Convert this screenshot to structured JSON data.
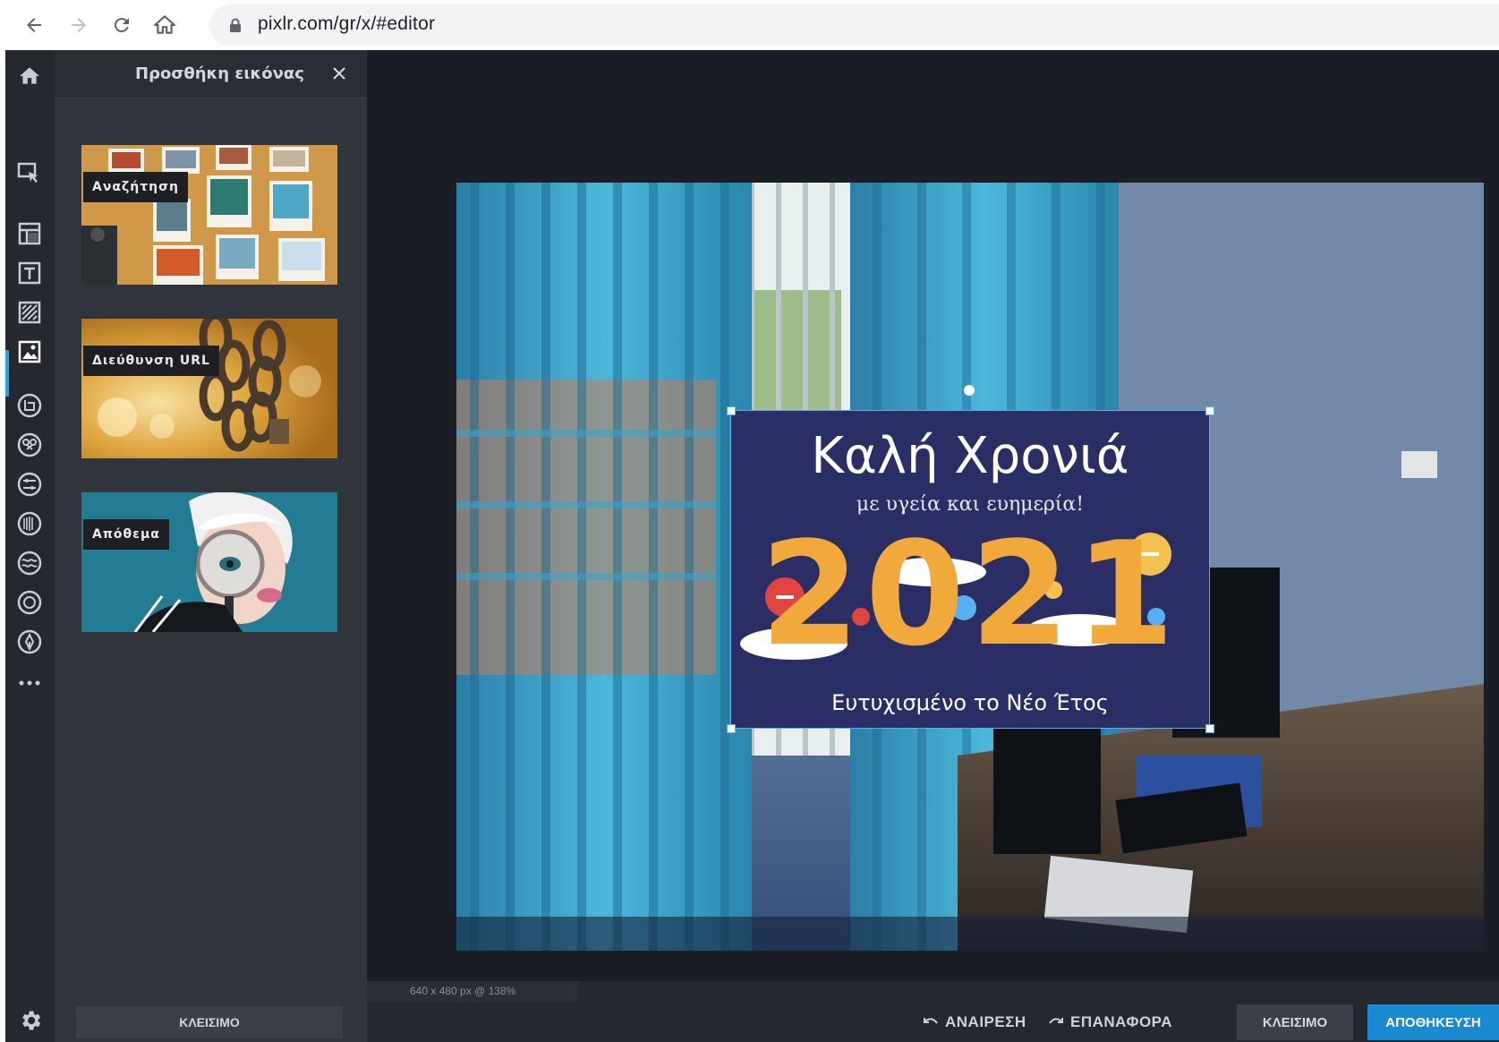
{
  "browser": {
    "url": "pixlr.com/gr/x/#editor"
  },
  "panel": {
    "title": "Προσθήκη εικόνας",
    "tiles": [
      {
        "label": "Αναζήτηση"
      },
      {
        "label": "Διεύθυνση URL"
      },
      {
        "label": "Απόθεμα"
      }
    ],
    "close_label": "ΚΛΕΙΣΙΜΟ"
  },
  "overlay": {
    "title": "Καλή Χρονιά",
    "subtitle": "με υγεία και ευημερία!",
    "year": "2021",
    "footer": "Ευτυχισμένο το Νέο Έτος"
  },
  "status": {
    "info": "640 x 480 px @ 138%"
  },
  "bottom": {
    "undo_label": "ΑΝΑΙΡΕΣΗ",
    "redo_label": "ΕΠΑΝΑΦΟΡΑ",
    "close_label": "ΚΛΕΙΣΙΜΟ",
    "save_label": "ΑΠΟΘΗΚΕΥΣΗ"
  },
  "colors": {
    "accent": "#1a8ad0",
    "toolbar_bg": "#25282e",
    "panel_bg": "#30343b",
    "workspace_bg": "#1b1e24"
  }
}
